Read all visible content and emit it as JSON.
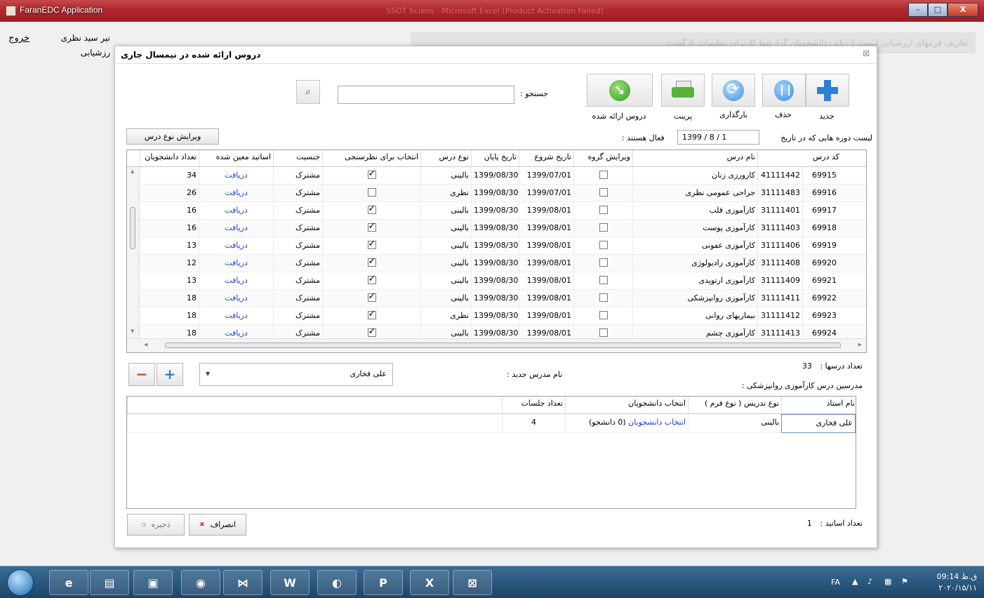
{
  "window": {
    "title": "FaranEDC Application",
    "ghost_title": "SSOT Sciens - Microsoft Excel (Product Activation Failed)",
    "minimize": "–",
    "maximize": "□",
    "close": "X"
  },
  "app": {
    "exit_label": "خروج",
    "user_line1": "نیر سید نظری",
    "user_line2": "رزشیابی",
    "ghost_menu": "تعاریف  فرمهای ارزشیابی  لیست ارزیابی  دانشجویان  گزارشها  کاربران  تنظیمات  بازگشت"
  },
  "dialog": {
    "title": "دروس ارائه شده در نیمسال جاری",
    "close": "☒"
  },
  "toolbar": {
    "new_label": "جدید",
    "delete_label": "حذف",
    "reload_label": "بارگذاری",
    "print_label": "پرینت",
    "offered_label": "دروس ارائه شده"
  },
  "search": {
    "label": "جستجو :",
    "value": "",
    "placeholder": ""
  },
  "filter": {
    "caption": "لیست دوره هایی که در تاریخ",
    "date": "1399  /  8  /  1",
    "active_label": "فعال هستند :",
    "edit_type_button": "ویرایش نوع درس"
  },
  "grid": {
    "headers": {
      "code": "کد درس",
      "name": "نام درس",
      "edit_group": "ویرایش گروه",
      "start_date": "تاریخ شروع",
      "end_date": "تاریخ پایان",
      "type": "نوع درس",
      "evaluation": "انتخاب برای نظرسنجی",
      "gender": "جنسیت",
      "teachers": "اساتید معین شده",
      "students": "تعداد دانشجویان"
    },
    "rows": [
      {
        "id": "69915",
        "code": "41111442",
        "name": "کارورزی زنان",
        "start": "1399/07/01",
        "end": "1399/08/30",
        "type": "بالینی",
        "eval": true,
        "gender": "مشترک",
        "teachers": "دریافت",
        "students": "34"
      },
      {
        "id": "69916",
        "code": "31111483",
        "name": "جراحی عمومی نظری",
        "start": "1399/07/01",
        "end": "1399/08/30",
        "type": "نظری",
        "eval": false,
        "gender": "مشترک",
        "teachers": "دریافت",
        "students": "26"
      },
      {
        "id": "69917",
        "code": "31111401",
        "name": "کارآموزی قلب",
        "start": "1399/08/01",
        "end": "1399/08/30",
        "type": "بالینی",
        "eval": true,
        "gender": "مشترک",
        "teachers": "دریافت",
        "students": "16"
      },
      {
        "id": "69918",
        "code": "31111403",
        "name": "کارآموزی پوست",
        "start": "1399/08/01",
        "end": "1399/08/30",
        "type": "بالینی",
        "eval": true,
        "gender": "مشترک",
        "teachers": "دریافت",
        "students": "16"
      },
      {
        "id": "69919",
        "code": "31111406",
        "name": "کارآموزی عفونی",
        "start": "1399/08/01",
        "end": "1399/08/30",
        "type": "بالینی",
        "eval": true,
        "gender": "مشترک",
        "teachers": "دریافت",
        "students": "13"
      },
      {
        "id": "69920",
        "code": "31111408",
        "name": "کارآموزی رادیولوژی",
        "start": "1399/08/01",
        "end": "1399/08/30",
        "type": "بالینی",
        "eval": true,
        "gender": "مشترک",
        "teachers": "دریافت",
        "students": "12"
      },
      {
        "id": "69921",
        "code": "31111409",
        "name": "کارآموزی ارتوپدی",
        "start": "1399/08/01",
        "end": "1399/08/30",
        "type": "بالینی",
        "eval": true,
        "gender": "مشترک",
        "teachers": "دریافت",
        "students": "13"
      },
      {
        "id": "69922",
        "code": "31111411",
        "name": "کارآموزی روانپزشکی",
        "start": "1399/08/01",
        "end": "1399/08/30",
        "type": "بالینی",
        "eval": true,
        "gender": "مشترک",
        "teachers": "دریافت",
        "students": "18"
      },
      {
        "id": "69923",
        "code": "31111412",
        "name": "بیماریهای روانی",
        "start": "1399/08/01",
        "end": "1399/08/30",
        "type": "نظری",
        "eval": true,
        "gender": "مشترک",
        "teachers": "دریافت",
        "students": "18"
      },
      {
        "id": "69924",
        "code": "31111413",
        "name": "کارآموزی چشم",
        "start": "1399/08/01",
        "end": "1399/08/30",
        "type": "بالینی",
        "eval": true,
        "gender": "مشترک",
        "teachers": "دریافت",
        "students": "18"
      }
    ]
  },
  "lessons": {
    "count_label": "تعداد درسها :",
    "count": "33",
    "teachers_caption": "مدرسین درس کارآموزی روانپزشکی :"
  },
  "new_teacher": {
    "label": "نام مدرس جدید :",
    "selected": "علی فخاری",
    "remove": "−",
    "add": "+"
  },
  "teachers_grid": {
    "headers": {
      "name": "نام استاد",
      "teaching_type": "نوع تدریس ( نوع فرم )",
      "select_students": "انتخاب دانشجویان",
      "sessions": "تعداد جلسات"
    },
    "rows": [
      {
        "name": "علی فخاری",
        "teaching_type": "بالینی",
        "select_link": "انتخاب دانشجویان",
        "select_count": "(0 دانشجو)",
        "sessions": "4"
      }
    ]
  },
  "footer": {
    "count_label": "تعداد اساتید :",
    "count": "1",
    "cancel_label": "انصراف",
    "save_label": "ذخیره"
  },
  "taskbar": {
    "lang": "FA",
    "time": "ق.ظ 09:14",
    "date": "۲۰۲۰/۱۵/۱۱",
    "apps": [
      "ie-icon",
      "explorer-icon",
      "media-icon",
      "chrome-icon",
      "vs-icon",
      "word-icon",
      "firefox-icon",
      "powerpoint-icon",
      "excel-icon",
      "app-icon"
    ]
  }
}
